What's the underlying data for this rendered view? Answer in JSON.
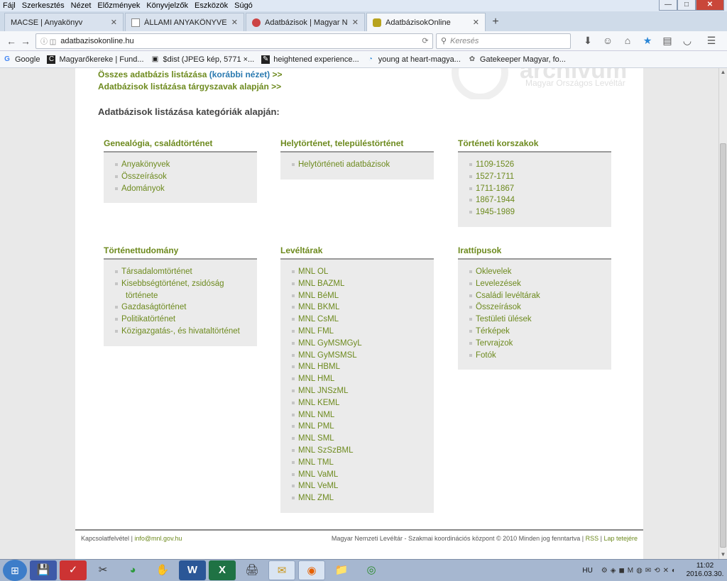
{
  "menubar": [
    "Fájl",
    "Szerkesztés",
    "Nézet",
    "Előzmények",
    "Könyvjelzők",
    "Eszközök",
    "Súgó"
  ],
  "window_controls": {
    "minimize": "—",
    "maximize": "□",
    "close": "✕"
  },
  "tabs": [
    {
      "label": "MACSE | Anyakönyv",
      "close": "✕"
    },
    {
      "label": "ÁLLAMI ANYAKÖNYVEK - ...",
      "close": "✕"
    },
    {
      "label": "Adatbázisok | Magyar Nem...",
      "close": "✕"
    },
    {
      "label": "AdatbázisokOnline",
      "close": "✕"
    }
  ],
  "new_tab": "+",
  "address": {
    "url": "adatbazisokonline.hu",
    "search_placeholder": "Keresés"
  },
  "bookmarks": [
    {
      "label": "Google",
      "icon": "G"
    },
    {
      "label": "Magyarőkereke | Fund...",
      "icon": "C"
    },
    {
      "label": "$dist (JPEG kép, 5771 ×...",
      "icon": "▣"
    },
    {
      "label": "heightened experience...",
      "icon": "✎"
    },
    {
      "label": "young at heart-magya...",
      "icon": "◔"
    },
    {
      "label": "Gatekeeper Magyar, fo...",
      "icon": "✿"
    }
  ],
  "content": {
    "watermark": {
      "text": "archivum",
      "sub": "Magyar Országos Levéltár"
    },
    "link_all": "Összes adatbázis listázása",
    "link_all_old": "(korábbi nézet)",
    "link_all_arrow": ">>",
    "link_subjects": "Adatbázisok listázása tárgyszavak alapján >>",
    "heading": "Adatbázisok listázása kategóriák alapján:",
    "categories": [
      {
        "title": "Genealógia, családtörténet",
        "items": [
          "Anyakönyvek",
          "Összeírások",
          "Adományok"
        ]
      },
      {
        "title": "Helytörténet, településtörténet",
        "items": [
          "Helytörténeti adatbázisok"
        ]
      },
      {
        "title": "Történeti korszakok",
        "items": [
          "1109-1526",
          "1527-1711",
          "1711-1867",
          "1867-1944",
          "1945-1989"
        ]
      },
      {
        "title": "Történettudomány",
        "items": [
          "Társadalomtörténet",
          "Kisebbségtörténet, zsidóság",
          "története",
          "Gazdaságtörténet",
          "Politikatörténet",
          "Közigazgatás-, és hivataltörténet"
        ]
      },
      {
        "title": "Levéltárak",
        "items": [
          "MNL OL",
          "MNL BAZML",
          "MNL BéML",
          "MNL BKML",
          "MNL CsML",
          "MNL FML",
          "MNL GyMSMGyL",
          "MNL GyMSMSL",
          "MNL HBML",
          "MNL HML",
          "MNL JNSzML",
          "MNL KEML",
          "MNL NML",
          "MNL PML",
          "MNL SML",
          "MNL SzSzBML",
          "MNL TML",
          "MNL VaML",
          "MNL VeML",
          "MNL ZML"
        ]
      },
      {
        "title": "Irattípusok",
        "items": [
          "Oklevelek",
          "Levelezések",
          "Családi levéltárak",
          "Összeírások",
          "Testületi ülések",
          "Térképek",
          "Tervrajzok",
          "Fotók"
        ]
      }
    ],
    "footer": {
      "contact": "Kapcsolatfelvétel",
      "email": "info@mnl.gov.hu",
      "copyright": "Magyar Nemzeti Levéltár - Szakmai koordinációs központ © 2010 Minden jog fenntartva",
      "rss": "RSS",
      "top": "Lap tetejére"
    }
  },
  "taskbar": {
    "start": "⊞",
    "apps": [
      "💾",
      "✓",
      "✂",
      "◕",
      "✋",
      "W",
      "X",
      "🖨",
      "✉",
      "◉",
      "📁",
      "◎"
    ],
    "lang": "HU",
    "tray": "⚙◈◼M◍✉⟲✕◐",
    "time": "11:02",
    "date": "2016.03.30."
  }
}
